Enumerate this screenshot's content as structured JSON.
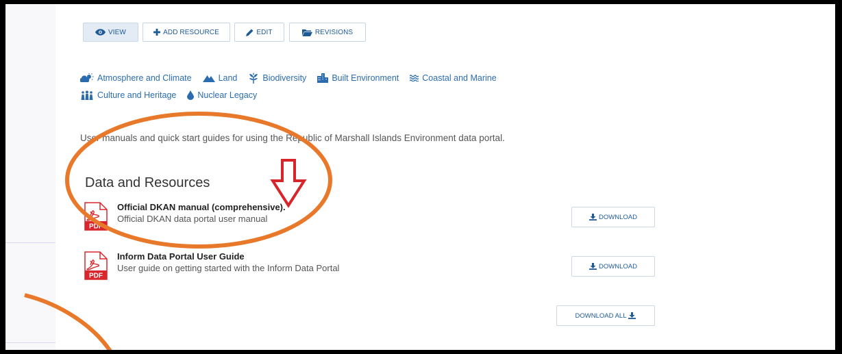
{
  "toolbar": {
    "view_label": "VIEW",
    "add_resource_label": "ADD RESOURCE",
    "edit_label": "EDIT",
    "revisions_label": "REVISIONS"
  },
  "tags": [
    {
      "label": "Atmosphere and Climate",
      "icon": "cloud-sun-icon"
    },
    {
      "label": "Land",
      "icon": "mountain-icon"
    },
    {
      "label": "Biodiversity",
      "icon": "leaf-icon"
    },
    {
      "label": "Built Environment",
      "icon": "building-icon"
    },
    {
      "label": "Coastal and Marine",
      "icon": "waves-icon"
    },
    {
      "label": "Culture and Heritage",
      "icon": "people-icon"
    },
    {
      "label": "Nuclear Legacy",
      "icon": "drop-icon"
    }
  ],
  "description": "User manuals and quick start guides for using the Republic of Marshall Islands Environment data portal.",
  "section_title": "Data and Resources",
  "resources": [
    {
      "title": "Official DKAN manual (comprehensive).",
      "subtitle": "Official DKAN data portal user manual",
      "format": "PDF",
      "download_label": "DOWNLOAD"
    },
    {
      "title": "Inform Data Portal User Guide",
      "subtitle": "User guide on getting started with the Inform Data Portal",
      "format": "PDF",
      "download_label": "DOWNLOAD"
    }
  ],
  "download_all_label": "DOWNLOAD ALL",
  "colors": {
    "link": "#2b6cb0",
    "annotation_orange": "#e8792b",
    "arrow_red": "#d6262b",
    "pdf_red": "#d9262c"
  }
}
